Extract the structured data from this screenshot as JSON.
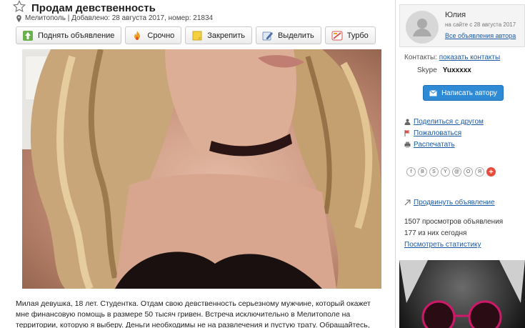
{
  "listing": {
    "title": "Продам девственность",
    "meta": "Мелитополь | Добавлено: 28 августа 2017, номер: 21834",
    "description": "Милая девушка, 18 лет. Студентка. Отдам свою девственность серьезному мужчине, который окажет мне финансовую помощь в размере 50 тысяч гривен. Встреча исключительно в Мелитополе на территории, которую я выберу. Деньги необходимы не на развлечения и пустую трату. Обращайтесь, дождуйсть, в"
  },
  "toolbar": {
    "raise": "Поднять объявление",
    "urgent": "Срочно",
    "pin": "Закрепить",
    "highlight": "Выделить",
    "turbo": "Турбо"
  },
  "author": {
    "name": "Юлия",
    "since": "на сайте с 28 августа 2017",
    "all_ads_link": "Все объявления автора"
  },
  "contacts": {
    "label": "Контакты:",
    "show_link": "показать контакты",
    "skype_label": "Skype",
    "skype_value": "Yuxxxxx"
  },
  "message_button": "Написать автору",
  "actions": {
    "share": "Поделиться с другом",
    "complain": "Пожаловаться",
    "print": "Распечатать"
  },
  "social_icons": [
    "f",
    "В",
    "S",
    "Y",
    "@",
    "O",
    "Я"
  ],
  "promote": "Продвинуть объявление",
  "stats": {
    "views": "1507 просмотров объявления",
    "today": "177 из них сегодня",
    "link": "Посмотреть статистику"
  },
  "colors": {
    "accent": "#2f8ad6",
    "link": "#1a5aa6",
    "plus": "#e74c3c"
  }
}
